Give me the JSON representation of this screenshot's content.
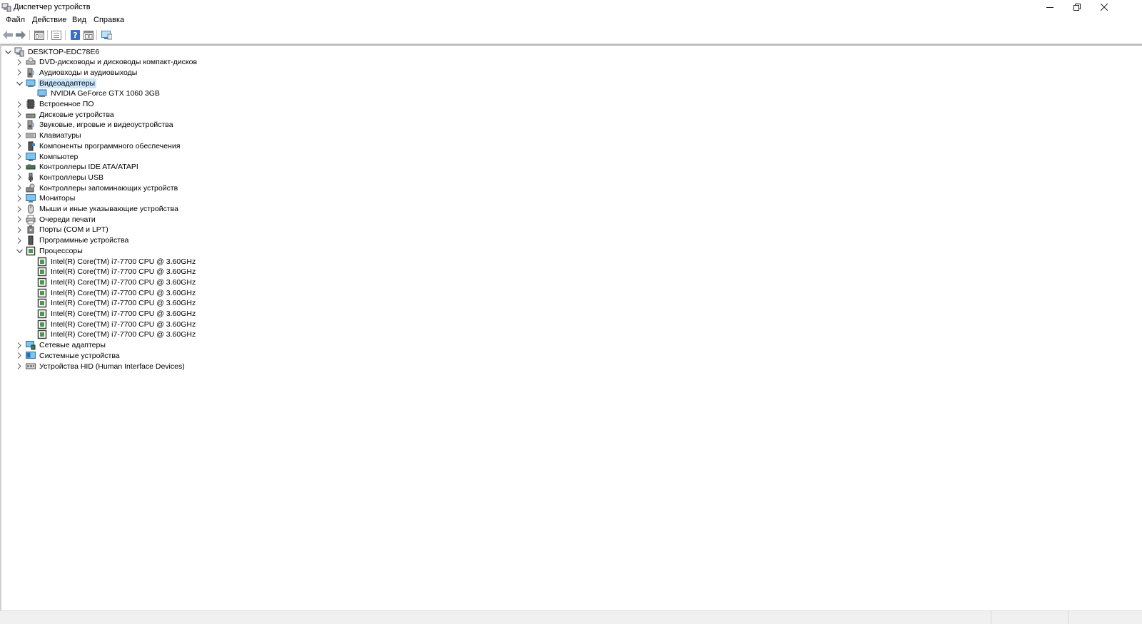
{
  "window": {
    "title": "Диспетчер устройств"
  },
  "menu": [
    {
      "label": "Файл"
    },
    {
      "label": "Действие"
    },
    {
      "label": "Вид"
    },
    {
      "label": "Справка"
    }
  ],
  "toolbar": [
    {
      "icon": "back-arrow-icon"
    },
    {
      "icon": "forward-arrow-icon"
    },
    {
      "icon": "properties-icon"
    },
    {
      "icon": "list-icon"
    },
    {
      "icon": "help-icon"
    },
    {
      "icon": "view-icon"
    },
    {
      "icon": "monitor-icon"
    }
  ],
  "tree": {
    "root": "DESKTOP-EDC78E6",
    "items": [
      {
        "label": "DVD-дисководы и дисководы компакт-дисков",
        "icon": "dvd-icon",
        "expanded": false
      },
      {
        "label": "Аудиовходы и аудиовыходы",
        "icon": "speaker-icon",
        "expanded": false
      },
      {
        "label": "Видеоадаптеры",
        "icon": "display-adapter-icon",
        "expanded": true,
        "selected": true,
        "children": [
          {
            "label": "NVIDIA GeForce GTX 1060 3GB",
            "icon": "display-adapter-icon"
          }
        ]
      },
      {
        "label": "Встроенное ПО",
        "icon": "firmware-icon",
        "expanded": false
      },
      {
        "label": "Дисковые устройства",
        "icon": "disk-icon",
        "expanded": false
      },
      {
        "label": "Звуковые, игровые и видеоустройства",
        "icon": "speaker-icon",
        "expanded": false
      },
      {
        "label": "Клавиатуры",
        "icon": "keyboard-icon",
        "expanded": false
      },
      {
        "label": "Компоненты программного обеспечения",
        "icon": "software-component-icon",
        "expanded": false
      },
      {
        "label": "Компьютер",
        "icon": "computer-icon",
        "expanded": false
      },
      {
        "label": "Контроллеры IDE ATA/ATAPI",
        "icon": "ide-controller-icon",
        "expanded": false
      },
      {
        "label": "Контроллеры USB",
        "icon": "usb-icon",
        "expanded": false
      },
      {
        "label": "Контроллеры запоминающих устройств",
        "icon": "storage-controller-icon",
        "expanded": false
      },
      {
        "label": "Мониторы",
        "icon": "monitor-icon",
        "expanded": false
      },
      {
        "label": "Мыши и иные указывающие устройства",
        "icon": "mouse-icon",
        "expanded": false
      },
      {
        "label": "Очереди печати",
        "icon": "printer-icon",
        "expanded": false
      },
      {
        "label": "Порты (COM и LPT)",
        "icon": "port-icon",
        "expanded": false
      },
      {
        "label": "Программные устройства",
        "icon": "software-device-icon",
        "expanded": false
      },
      {
        "label": "Процессоры",
        "icon": "processor-icon",
        "expanded": true,
        "children": [
          {
            "label": "Intel(R) Core(TM) i7-7700 CPU @ 3.60GHz",
            "icon": "processor-icon"
          },
          {
            "label": "Intel(R) Core(TM) i7-7700 CPU @ 3.60GHz",
            "icon": "processor-icon"
          },
          {
            "label": "Intel(R) Core(TM) i7-7700 CPU @ 3.60GHz",
            "icon": "processor-icon"
          },
          {
            "label": "Intel(R) Core(TM) i7-7700 CPU @ 3.60GHz",
            "icon": "processor-icon"
          },
          {
            "label": "Intel(R) Core(TM) i7-7700 CPU @ 3.60GHz",
            "icon": "processor-icon"
          },
          {
            "label": "Intel(R) Core(TM) i7-7700 CPU @ 3.60GHz",
            "icon": "processor-icon"
          },
          {
            "label": "Intel(R) Core(TM) i7-7700 CPU @ 3.60GHz",
            "icon": "processor-icon"
          },
          {
            "label": "Intel(R) Core(TM) i7-7700 CPU @ 3.60GHz",
            "icon": "processor-icon"
          }
        ]
      },
      {
        "label": "Сетевые адаптеры",
        "icon": "network-adapter-icon",
        "expanded": false
      },
      {
        "label": "Системные устройства",
        "icon": "system-device-icon",
        "expanded": false
      },
      {
        "label": "Устройства HID (Human Interface Devices)",
        "icon": "hid-icon",
        "expanded": false
      }
    ]
  },
  "colors": {
    "selection": "#cce8ff",
    "accent": "#3a86c8"
  }
}
